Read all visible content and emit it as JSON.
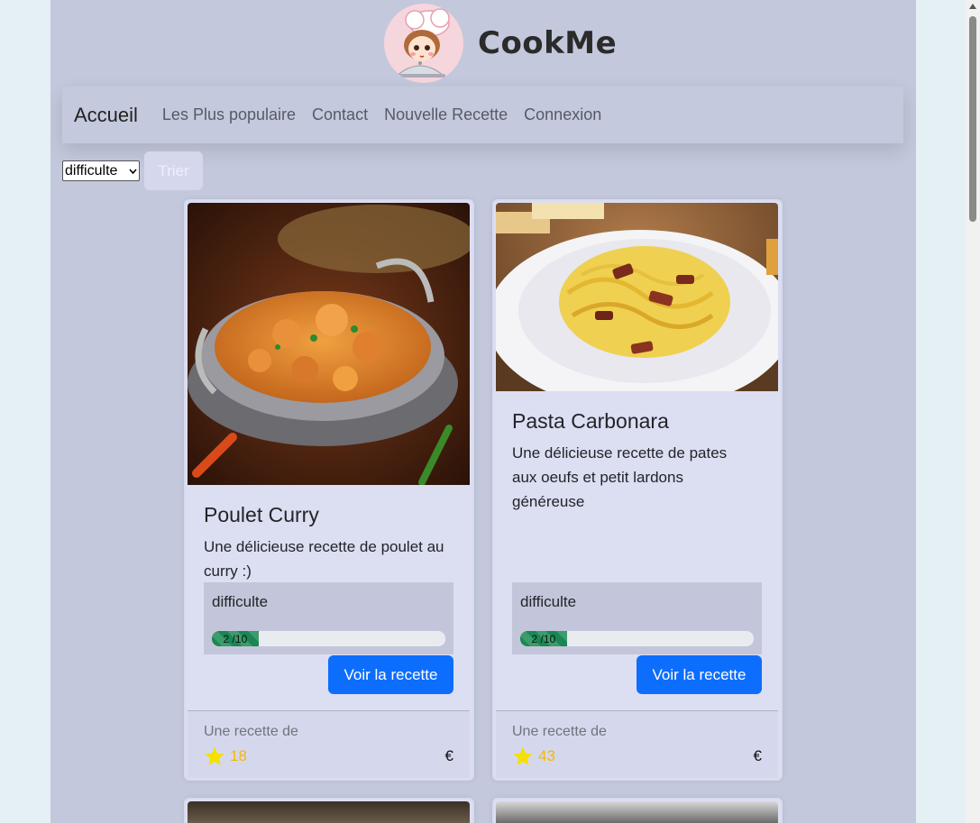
{
  "brand": {
    "title": "CookMe"
  },
  "nav": {
    "brand": "Accueil",
    "links": [
      "Les Plus populaire",
      "Contact",
      "Nouvelle Recette",
      "Connexion"
    ]
  },
  "sort": {
    "selected": "difficulte",
    "button": "Trier"
  },
  "cards": [
    {
      "title": "Poulet Curry",
      "description": "Une délicieuse recette de poulet au curry :)",
      "difficulty_label": "difficulte",
      "difficulty_text": "2 /10",
      "difficulty_value": 0.2,
      "button": "Voir la recette",
      "footer_by": "Une recette de",
      "rating": "18",
      "price": "€"
    },
    {
      "title": "Pasta Carbonara",
      "description": "Une délicieuse recette de pates aux oeufs et petit lardons généreuse",
      "difficulty_label": "difficulte",
      "difficulty_text": "2 /10",
      "difficulty_value": 0.2,
      "button": "Voir la recette",
      "footer_by": "Une recette de",
      "rating": "43",
      "price": "€"
    }
  ],
  "colors": {
    "page_bg": "#c3c8dc",
    "card_bg": "#dcdef2",
    "primary": "#0d6efd",
    "progress": "#198754",
    "star": "#f5d800"
  }
}
